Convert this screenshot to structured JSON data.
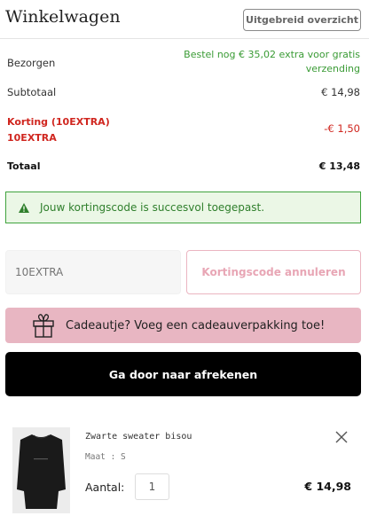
{
  "header": {
    "title": "Winkelwagen",
    "overview_button": "Uitgebreid overzicht"
  },
  "summary": {
    "delivered_label": "Bezorgen",
    "delivered_value": "Bestel nog € 35,02 extra voor gratis verzending",
    "subtotal_label": "Subtotaal",
    "subtotal_value": "€ 14,98",
    "discount_label": "Korting (10EXTRA)",
    "discount_code": "10EXTRA",
    "discount_value": "-€ 1,50",
    "total_label": "Totaal",
    "total_value": "€ 13,48"
  },
  "success_message": "Jouw kortingscode is succesvol toegepast.",
  "coupon": {
    "placeholder": "10EXTRA",
    "cancel_label": "Kortingscode annuleren"
  },
  "gift": {
    "label": "Cadeautje? Voeg een cadeauverpakking toe!"
  },
  "checkout": {
    "label": "Ga door naar afrekenen"
  },
  "product": {
    "name": "Zwarte sweater bisou",
    "size": "Maat : S",
    "quantity_label": "Aantal:",
    "quantity": "1",
    "price": "€ 14,98"
  },
  "colors": {
    "success_green": "#40a33e",
    "discount_red": "#d0261f",
    "gift_pink": "#e8b6c2",
    "checkout_black": "#000000"
  }
}
